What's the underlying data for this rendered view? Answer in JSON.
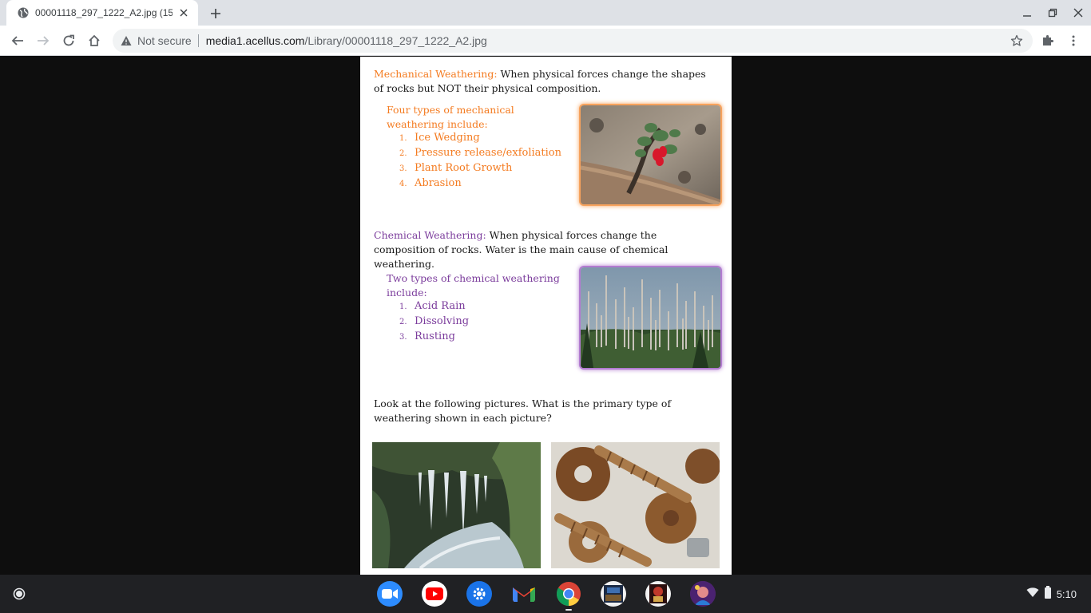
{
  "browser": {
    "tab": {
      "title": "00001118_297_1222_A2.jpg (15"
    },
    "omnibox": {
      "security_label": "Not secure",
      "url_host": "media1.acellus.com",
      "url_path": "/Library/00001118_297_1222_A2.jpg"
    }
  },
  "document": {
    "mechanical": {
      "term": "Mechanical Weathering:",
      "definition": "When physical forces change the shapes of rocks but NOT their physical composition.",
      "list_intro": "Four types of mechanical weathering include:",
      "items": [
        {
          "num": "1.",
          "label": "Ice Wedging"
        },
        {
          "num": "2.",
          "label": "Pressure release/exfoliation"
        },
        {
          "num": "3.",
          "label": "Plant Root Growth"
        },
        {
          "num": "4.",
          "label": "Abrasion"
        }
      ]
    },
    "chemical": {
      "term": "Chemical Weathering:",
      "definition": "When physical forces change the composition of rocks. Water is the main cause of chemical weathering.",
      "list_intro": "Two types of chemical weathering include:",
      "items": [
        {
          "num": "1.",
          "label": "Acid Rain"
        },
        {
          "num": "2.",
          "label": "Dissolving"
        },
        {
          "num": "3.",
          "label": "Rusting"
        }
      ]
    },
    "question": "Look at the following pictures. What is the primary type of weathering shown in each picture?"
  },
  "shelf": {
    "apps": [
      "zoom-app",
      "youtube-app",
      "settings-app",
      "gmail-app",
      "chrome-app",
      "game-app-1",
      "game-app-2",
      "game-app-3"
    ],
    "time": "5:10"
  },
  "colors": {
    "mechanical_accent": "#f47b20",
    "chemical_accent": "#7b3c9c"
  }
}
